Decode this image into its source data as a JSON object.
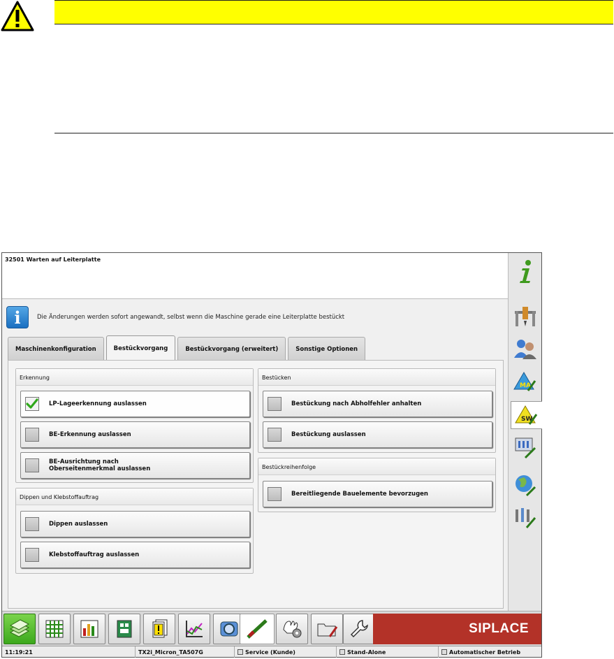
{
  "screen": {
    "title": "32501 Warten auf Leiterplatte",
    "info_message": "Die Änderungen werden sofort angewandt, selbst wenn die Maschine gerade eine Leiterplatte bestückt"
  },
  "tabs": [
    {
      "label": "Maschinenkonfiguration",
      "active": false
    },
    {
      "label": "Bestückvorgang",
      "active": true
    },
    {
      "label": "Bestückvorgang (erweitert)",
      "active": false
    },
    {
      "label": "Sonstige Optionen",
      "active": false
    }
  ],
  "groups": {
    "erkennung": {
      "title": "Erkennung",
      "options": [
        {
          "label": "LP-Lageerkennung auslassen",
          "checked": true
        },
        {
          "label": "BE-Erkennung auslassen",
          "checked": false
        },
        {
          "label_line1": "BE-Ausrichtung nach",
          "label_line2": "Oberseitenmerkmal auslassen",
          "checked": false
        }
      ]
    },
    "dippen": {
      "title": "Dippen und Klebstoffauftrag",
      "options": [
        {
          "label": "Dippen auslassen",
          "checked": false
        },
        {
          "label": "Klebstoffauftrag auslassen",
          "checked": false
        }
      ]
    },
    "bestuecken": {
      "title": "Bestücken",
      "options": [
        {
          "label": "Bestückung nach Abholfehler anhalten",
          "checked": false
        },
        {
          "label": "Bestückung auslassen",
          "checked": false
        }
      ]
    },
    "reihenfolge": {
      "title": "Bestückreihenfolge",
      "options": [
        {
          "label": "Bereitliegende Bauelemente bevorzugen",
          "checked": false
        }
      ]
    }
  },
  "side_toolbar": [
    "info-icon",
    "machine-icon",
    "users-icon",
    "ma-icon",
    "sw-icon",
    "station-icon",
    "globe-icon",
    "tools-icon"
  ],
  "bottom_toolbar": [
    "home-icon",
    "grid-icon",
    "bar-chart-icon",
    "board-icon",
    "warning-cards-icon",
    "line-chart-icon",
    "camera-icon",
    "nozzle-icon",
    "hand-gear-icon",
    "folder-icon",
    "wrench-icon"
  ],
  "brand": "SIPLACE",
  "statusbar": {
    "time": "11:19:21",
    "recipe": "TX2i_Micron_TA507G",
    "user": "Service (Kunde)",
    "mode": "Stand-Alone",
    "operation": "Automatischer Betrieb"
  },
  "colors": {
    "warning_bar": "#ffff00",
    "brand_red": "#b33228",
    "home_green": "#3ca81c",
    "check_green": "#2fa81a"
  }
}
